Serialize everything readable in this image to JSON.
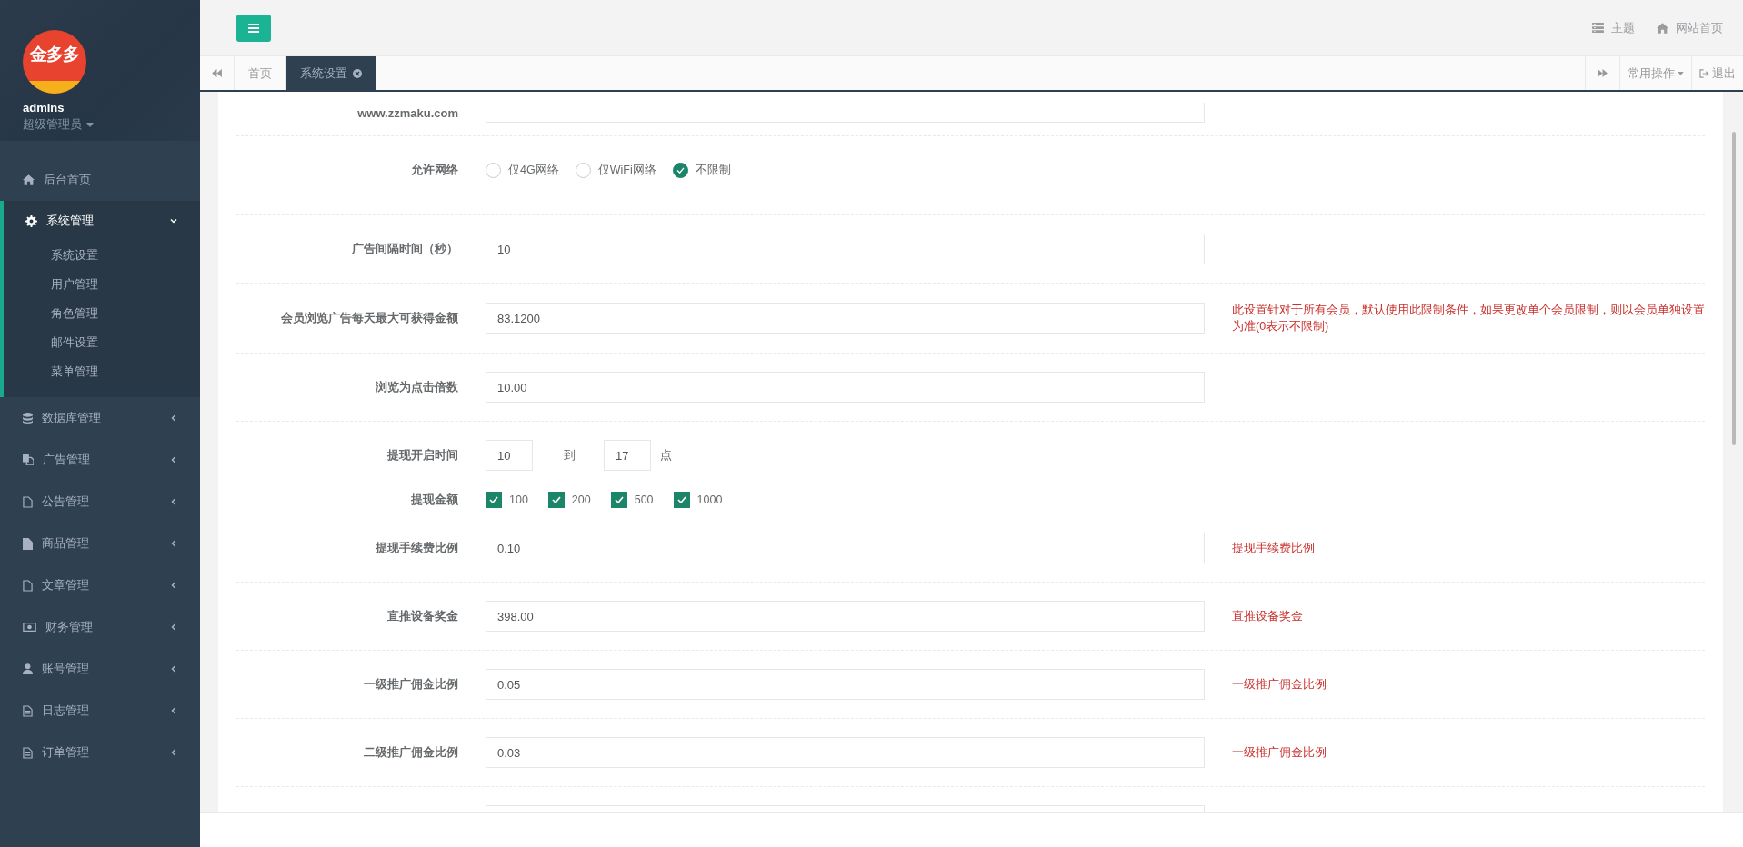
{
  "sidebar": {
    "logo_text": "金多多",
    "user": "admins",
    "role": "超级管理员",
    "items": [
      {
        "label": "后台首页",
        "kind": "link"
      },
      {
        "label": "系统管理",
        "kind": "group",
        "expanded": true,
        "children": [
          {
            "label": "系统设置"
          },
          {
            "label": "用户管理"
          },
          {
            "label": "角色管理"
          },
          {
            "label": "邮件设置"
          },
          {
            "label": "菜单管理"
          }
        ]
      },
      {
        "label": "数据库管理",
        "kind": "group",
        "expanded": false
      },
      {
        "label": "广告管理",
        "kind": "group",
        "expanded": false
      },
      {
        "label": "公告管理",
        "kind": "group",
        "expanded": false
      },
      {
        "label": "商品管理",
        "kind": "group",
        "expanded": false
      },
      {
        "label": "文章管理",
        "kind": "group",
        "expanded": false
      },
      {
        "label": "财务管理",
        "kind": "group",
        "expanded": false
      },
      {
        "label": "账号管理",
        "kind": "group",
        "expanded": false
      },
      {
        "label": "日志管理",
        "kind": "group",
        "expanded": false
      },
      {
        "label": "订单管理",
        "kind": "group",
        "expanded": false
      }
    ]
  },
  "header": {
    "links": [
      {
        "label": "主题"
      },
      {
        "label": "网站首页"
      }
    ]
  },
  "tabs": [
    {
      "label": "首页",
      "selected": false
    },
    {
      "label": "系统设置",
      "selected": true
    }
  ],
  "tab_actions": {
    "menu": "常用操作",
    "exit": "退出"
  },
  "form": {
    "sections": [
      {
        "fields": [
          {
            "kind": "text",
            "label": "www.zzmaku.com"
          }
        ]
      },
      {
        "fields": [
          {
            "kind": "radio",
            "label": "允许网络",
            "options": [
              {
                "label": "仅4G网络",
                "selected": false
              },
              {
                "label": "仅WiFi网络",
                "selected": false
              },
              {
                "label": "不限制",
                "selected": true
              }
            ]
          }
        ]
      },
      {
        "fields": [
          {
            "kind": "text",
            "label": "广告间隔时间（秒）",
            "value": "10"
          }
        ]
      },
      {
        "fields": [
          {
            "kind": "text",
            "label": "会员浏览广告每天最大可获得金额",
            "value": "83.1200",
            "help": "此设置针对于所有会员，默认使用此限制条件，如果更改单个会员限制，则以会员单独设置为准(0表示不限制)"
          }
        ]
      },
      {
        "fields": [
          {
            "kind": "text",
            "label": "浏览为点击倍数",
            "value": "10.00"
          }
        ]
      },
      {
        "fields": [
          {
            "kind": "range",
            "label": "提现开启时间",
            "from": "10",
            "sep": "到",
            "to": "17",
            "unit": "点"
          },
          {
            "kind": "checkbox",
            "label": "提现金额",
            "options": [
              {
                "label": "100",
                "checked": true
              },
              {
                "label": "200",
                "checked": true
              },
              {
                "label": "500",
                "checked": true
              },
              {
                "label": "1000",
                "checked": true
              }
            ]
          },
          {
            "kind": "text",
            "label": "提现手续费比例",
            "value": "0.10",
            "help": "提现手续费比例"
          }
        ]
      },
      {
        "fields": [
          {
            "kind": "text",
            "label": "直推设备奖金",
            "value": "398.00",
            "help": "直推设备奖金"
          }
        ]
      },
      {
        "fields": [
          {
            "kind": "text",
            "label": "一级推广佣金比例",
            "value": "0.05",
            "help": "一级推广佣金比例"
          }
        ]
      },
      {
        "fields": [
          {
            "kind": "text",
            "label": "二级推广佣金比例",
            "value": "0.03",
            "help": "一级推广佣金比例"
          }
        ]
      },
      {
        "fields": [
          {
            "kind": "text"
          }
        ]
      }
    ]
  }
}
